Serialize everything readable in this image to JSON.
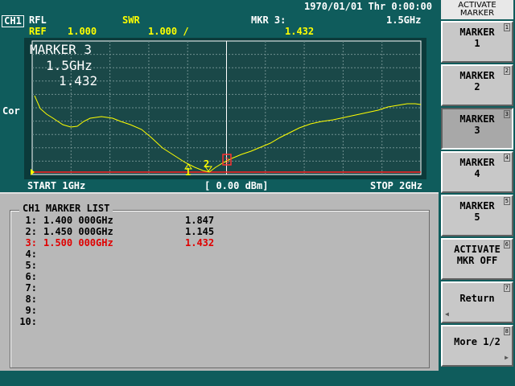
{
  "header": {
    "datetime": "1970/01/01 Thr   0:00:00",
    "ch": "CH1",
    "rfl": "RFL",
    "swr": "SWR",
    "mkr_label": "MKR 3:",
    "mkr_freq": "1.5GHz",
    "ref_label": "REF",
    "ref_value": "1.000",
    "scale": "1.000 /",
    "mkr_value": "1.432"
  },
  "graph": {
    "overlay_line1": "MARKER 3",
    "overlay_line2": "1.5GHz",
    "overlay_line3": "1.432",
    "side_label": "Cor",
    "marker_labels": [
      "1",
      "2",
      "3"
    ],
    "start": "START 1GHz",
    "power": "[ 0.00 dBm]",
    "stop": "STOP 2GHz"
  },
  "marker_list": {
    "title": "CH1 MARKER LIST",
    "rows": [
      {
        "num": "1:",
        "freq": "1.400 000GHz",
        "value": "1.847"
      },
      {
        "num": "2:",
        "freq": "1.450 000GHz",
        "value": "1.145"
      },
      {
        "num": "3:",
        "freq": "1.500 000GHz",
        "value": "1.432"
      },
      {
        "num": "4:",
        "freq": "",
        "value": ""
      },
      {
        "num": "5:",
        "freq": "",
        "value": ""
      },
      {
        "num": "6:",
        "freq": "",
        "value": ""
      },
      {
        "num": "7:",
        "freq": "",
        "value": ""
      },
      {
        "num": "8:",
        "freq": "",
        "value": ""
      },
      {
        "num": "9:",
        "freq": "",
        "value": ""
      },
      {
        "num": "10:",
        "freq": "",
        "value": ""
      }
    ]
  },
  "softkeys": {
    "title_line1": "ACTIVATE",
    "title_line2": "MARKER",
    "keys": [
      {
        "line1": "MARKER",
        "line2": "1",
        "num": "1"
      },
      {
        "line1": "MARKER",
        "line2": "2",
        "num": "2"
      },
      {
        "line1": "MARKER",
        "line2": "3",
        "num": "3"
      },
      {
        "line1": "MARKER",
        "line2": "4",
        "num": "4"
      },
      {
        "line1": "MARKER",
        "line2": "5",
        "num": "5"
      },
      {
        "line1": "ACTIVATE",
        "line2": "MKR OFF",
        "num": "6"
      },
      {
        "line1": "Return",
        "line2": "",
        "num": "7"
      },
      {
        "line1": "More 1/2",
        "line2": "",
        "num": "8"
      }
    ]
  },
  "colors": {
    "background": "#0f5c5c",
    "trace": "#ffff00",
    "reference_line": "#ff2020",
    "active_marker": "#e00000"
  }
}
